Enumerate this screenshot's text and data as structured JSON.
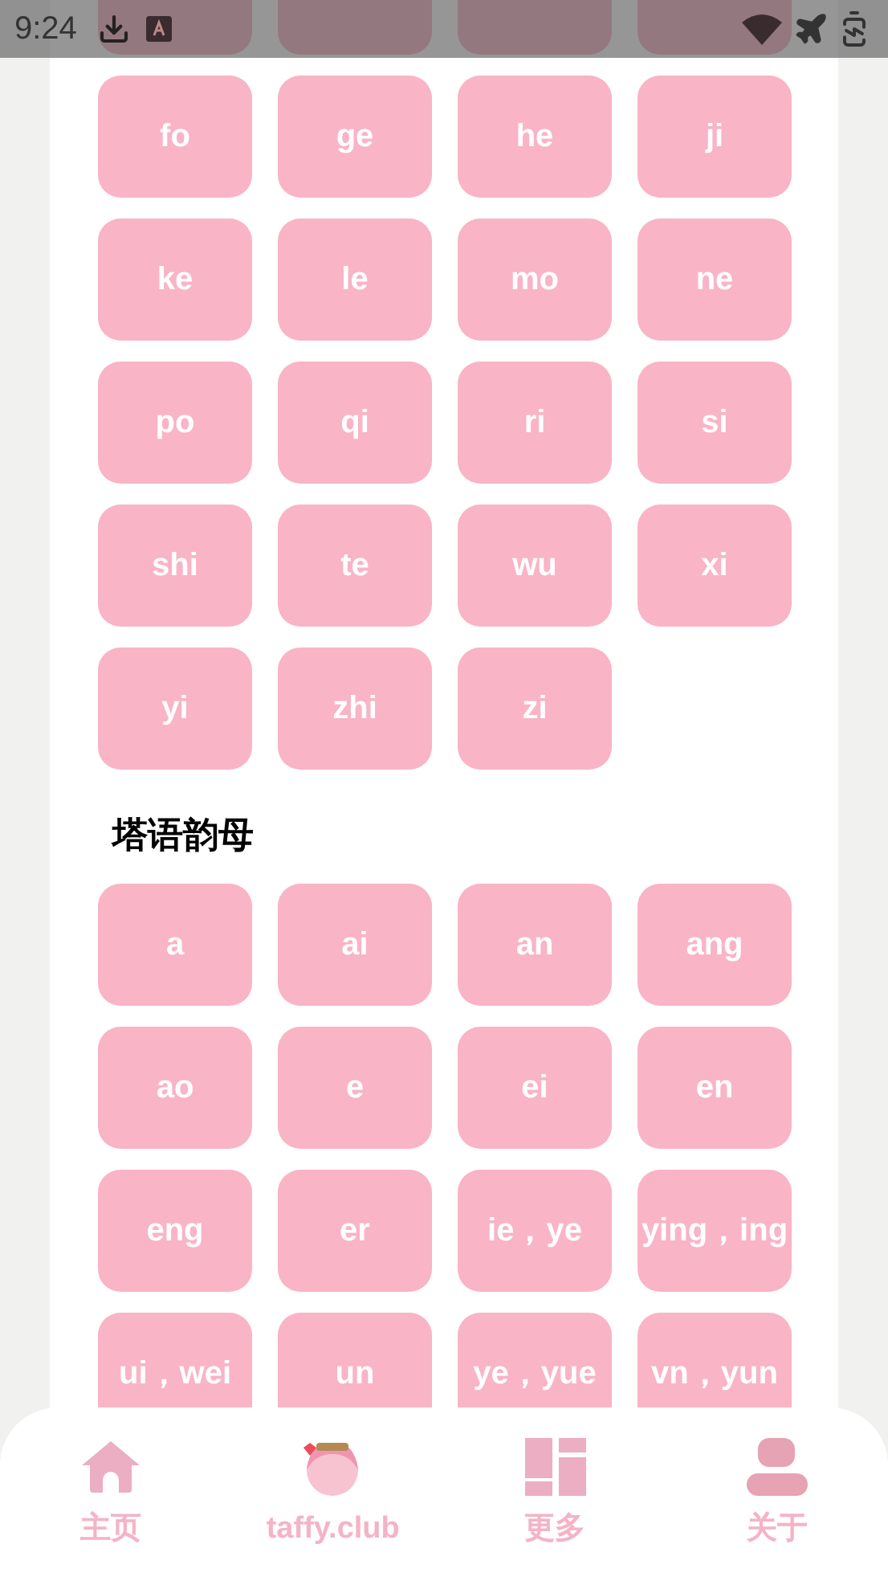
{
  "status_bar": {
    "time": "9:24"
  },
  "sections": [
    {
      "syllables": [
        "fo",
        "ge",
        "he",
        "ji",
        "ke",
        "le",
        "mo",
        "ne",
        "po",
        "qi",
        "ri",
        "si",
        "shi",
        "te",
        "wu",
        "xi",
        "yi",
        "zhi",
        "zi"
      ]
    },
    {
      "title": "塔语韵母",
      "syllables": [
        "a",
        "ai",
        "an",
        "ang",
        "ao",
        "e",
        "ei",
        "en",
        "eng",
        "er",
        "ie，ye",
        "ying，ing",
        "ui，wei",
        "un",
        "ye，yue",
        "vn，yun"
      ]
    }
  ],
  "nav": [
    {
      "kind": "home",
      "label": "主页"
    },
    {
      "kind": "avatar",
      "label": "taffy.club"
    },
    {
      "kind": "dashboard",
      "label": "更多"
    },
    {
      "kind": "person",
      "label": "关于"
    }
  ]
}
